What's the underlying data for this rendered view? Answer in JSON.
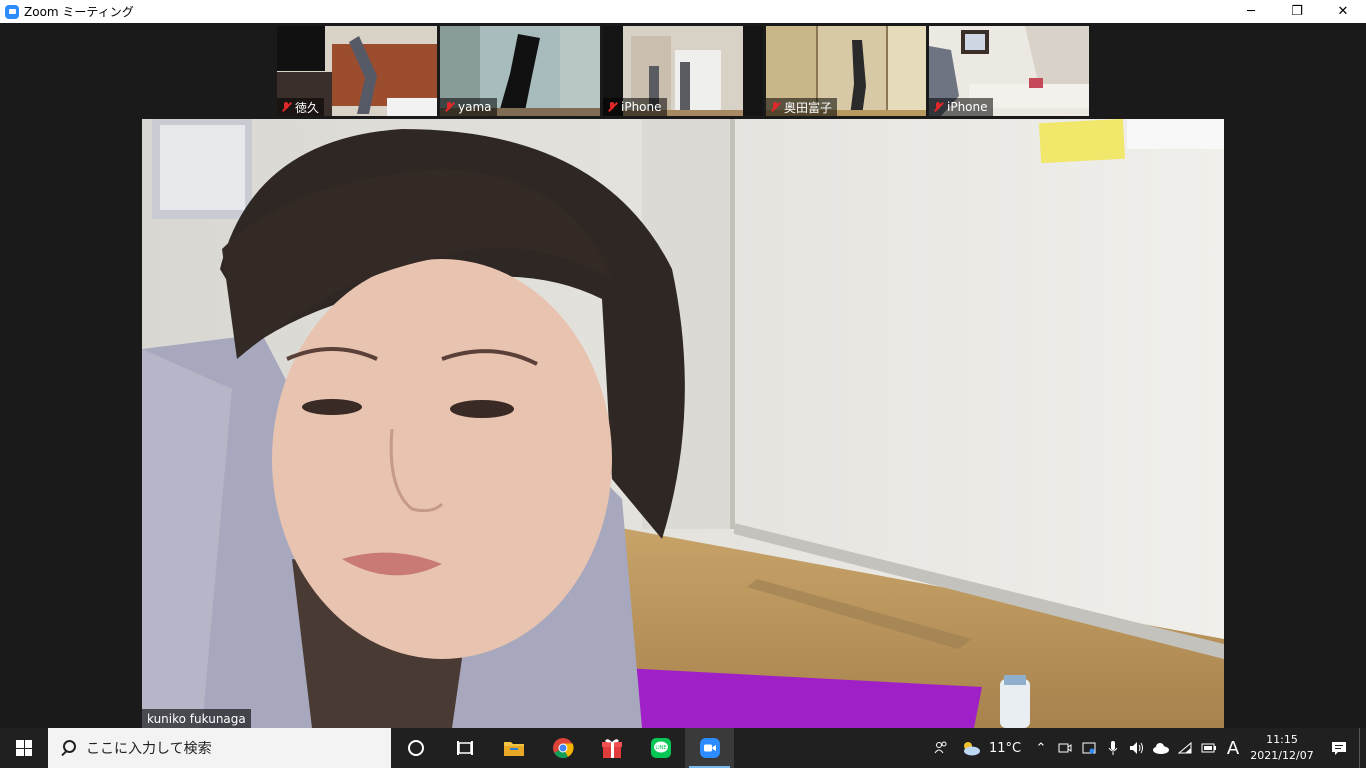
{
  "window": {
    "title": "Zoom ミーティング",
    "minimize_glyph": "─",
    "restore_glyph": "❐",
    "close_glyph": "✕"
  },
  "participants": [
    {
      "name": "徳久",
      "mic": "muted"
    },
    {
      "name": "yama",
      "mic": "muted"
    },
    {
      "name": "iPhone",
      "mic": "muted"
    },
    {
      "name": "奥田富子",
      "mic": "muted"
    },
    {
      "name": "iPhone",
      "mic": "muted"
    }
  ],
  "active_speaker": {
    "name": "kuniko fukunaga"
  },
  "taskbar": {
    "search_placeholder": "ここに入力して検索",
    "apps": [
      "cortana",
      "task-view",
      "file-explorer",
      "chrome",
      "gift",
      "line",
      "zoom"
    ],
    "weather": "11°C",
    "ime": "A",
    "time": "11:15",
    "date": "2021/12/07"
  },
  "colors": {
    "zoom_blue": "#2d8cff",
    "muted_red": "#e02828",
    "taskbar_bg": "#202020",
    "mat_purple": "#a020c8"
  }
}
